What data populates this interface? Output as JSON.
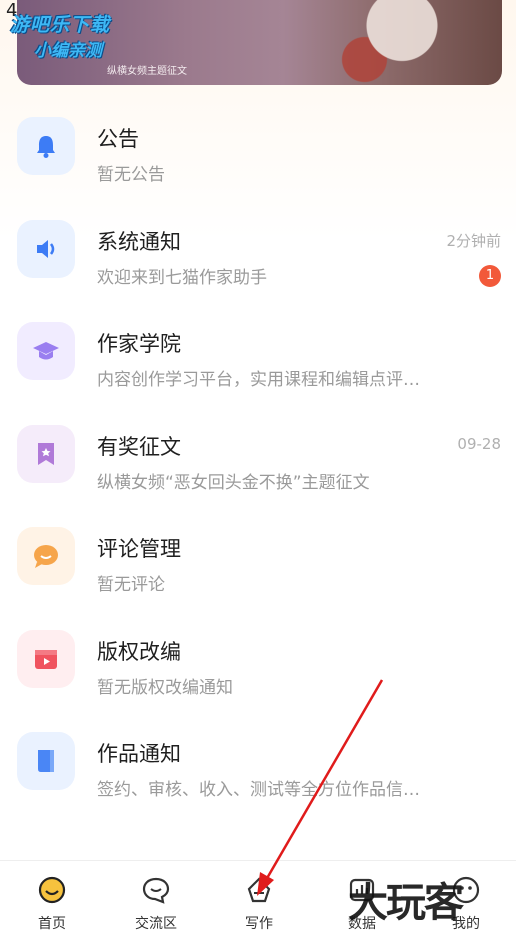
{
  "status": {
    "time": "4:25"
  },
  "watermark": {
    "line1": "游吧乐下载",
    "line2": "小编亲测",
    "corner": "大玩客"
  },
  "banner": {
    "subtitle": "纵横女频主题征文"
  },
  "messages": [
    {
      "title": "公告",
      "desc": "暂无公告",
      "time": "",
      "badge": "",
      "icon": "bell-icon",
      "bg": "#eaf2ff",
      "color": "#3d7cf5"
    },
    {
      "title": "系统通知",
      "desc": "欢迎来到七猫作家助手",
      "time": "2分钟前",
      "badge": "1",
      "icon": "speaker-icon",
      "bg": "#eaf2ff",
      "color": "#3d7cf5"
    },
    {
      "title": "作家学院",
      "desc": "内容创作学习平台，实用课程和编辑点评…",
      "time": "",
      "badge": "",
      "icon": "graduation-cap-icon",
      "bg": "#f1ecff",
      "color": "#9a7ef0"
    },
    {
      "title": "有奖征文",
      "desc": "纵横女频“恶女回头金不换”主题征文",
      "time": "09-28",
      "badge": "",
      "icon": "bookmark-icon",
      "bg": "#f5ecfa",
      "color": "#b07ad8"
    },
    {
      "title": "评论管理",
      "desc": "暂无评论",
      "time": "",
      "badge": "",
      "icon": "chat-bubble-icon",
      "bg": "#fff3e6",
      "color": "#f6a54b"
    },
    {
      "title": "版权改编",
      "desc": "暂无版权改编通知",
      "time": "",
      "badge": "",
      "icon": "video-icon",
      "bg": "#ffeef0",
      "color": "#f0535f"
    },
    {
      "title": "作品通知",
      "desc": "签约、审核、收入、测试等全方位作品信…",
      "time": "",
      "badge": "",
      "icon": "book-icon",
      "bg": "#eaf2ff",
      "color": "#4a86f5"
    }
  ],
  "tabs": [
    {
      "label": "首页",
      "icon": "home-face-icon"
    },
    {
      "label": "交流区",
      "icon": "chat-icon"
    },
    {
      "label": "写作",
      "icon": "pen-nib-icon"
    },
    {
      "label": "数据",
      "icon": "chart-icon"
    },
    {
      "label": "我的",
      "icon": "profile-icon"
    }
  ],
  "colors": {
    "accent": "#f6c23e",
    "badge": "#f2593a",
    "annotation": "#e01b1b"
  }
}
